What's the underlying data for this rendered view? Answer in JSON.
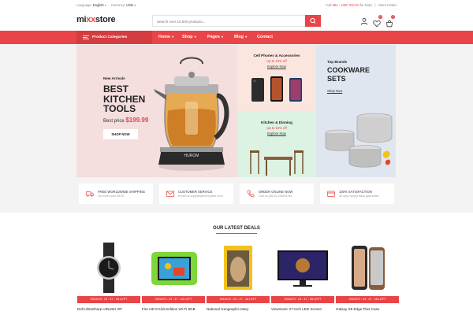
{
  "topbar": {
    "language_label": "Language:",
    "language_value": "English",
    "currency_label": "Currency:",
    "currency_value": "USD",
    "call_label": "Call",
    "phone": "084 - 1000 333 00",
    "help_text": "for help!",
    "store_finder": "Store Finder"
  },
  "header": {
    "logo_prefix": "mi",
    "logo_x": "xx",
    "logo_suffix": "store",
    "search_placeholder": "Search over 10,000 products...",
    "wishlist_count": "0",
    "cart_count": "0"
  },
  "nav": {
    "categories_label": "Product Categories",
    "items": [
      "Home",
      "Shop",
      "Pages",
      "Blog",
      "Contact"
    ]
  },
  "hero": {
    "main": {
      "kicker": "New Arrivals",
      "title_line1": "BEST",
      "title_line2": "KITCHEN",
      "title_line3": "TOOLS",
      "price_label": "Best price",
      "price": "$199.99",
      "button": "SHOP NOW",
      "product_brand": "HUROM"
    },
    "phones": {
      "title": "Cell Phones & Accessories",
      "offer": "Up to 15% off",
      "link": "Explore Now"
    },
    "kitchen": {
      "title": "Kitchen & Dinning",
      "offer": "Up to 15% off",
      "link": "Explore Now"
    },
    "cookware": {
      "kicker": "Top Brands",
      "title_line1": "COOKWARE",
      "title_line2": "SETS",
      "link": "Shop Now"
    }
  },
  "features": [
    {
      "title": "FREE WORLDWIDE SHIPPING",
      "sub": "On order over $100"
    },
    {
      "title": "CUSTOMER SERVICE",
      "sub": "Email us support@mixxstore.com"
    },
    {
      "title": "ORDER ONLINE NOW",
      "sub": "Call us (0011) 2345 6789"
    },
    {
      "title": "100% SATISFACTION",
      "sub": "30 day money back guarantee"
    }
  ],
  "deals": {
    "title": "OUR LATEST DEALS",
    "products": [
      {
        "name": "Dell UltraSharp U2515H 25\"",
        "badge": "90DAYS : 23 : 47 : 18 LEFT"
      },
      {
        "name": "Fire HD 8 Kids Edition Wi-Fi 8GB",
        "badge": "90DAYS : 23 : 47 : 18 LEFT"
      },
      {
        "name": "National Geographic Mary",
        "badge": "90DAYS : 23 : 47 : 18 LEFT"
      },
      {
        "name": "ViewSonic 27-Inch LED Screen",
        "badge": "90DAYS : 23 : 47 : 18 LEFT"
      },
      {
        "name": "Galaxy S8 Edge Plus Case",
        "badge": "90DAYS : 23 : 47 : 18 LEFT"
      }
    ]
  },
  "colors": {
    "accent": "#e94447",
    "accent_dark": "#d53c3f"
  }
}
